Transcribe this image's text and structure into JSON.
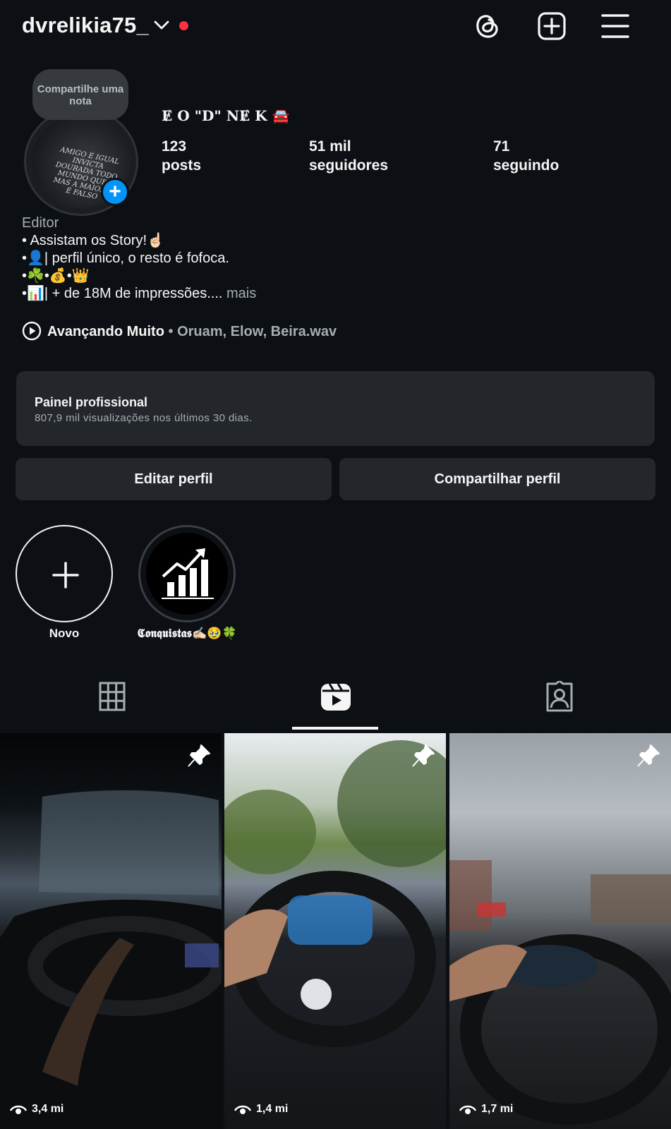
{
  "header": {
    "username": "dvrelikia75_",
    "icons": [
      "chevron-down-icon",
      "threads-icon",
      "create-post-icon",
      "menu-icon"
    ],
    "notification_dot_color": "#ff3040"
  },
  "profile": {
    "note": "Compartilhe uma nota",
    "display_name": "Ɇ O \"D\" NɆ K 🚘",
    "stats": [
      {
        "value": "123",
        "label": "posts"
      },
      {
        "value": "51 mil",
        "label": "seguidores"
      },
      {
        "value": "71",
        "label": "seguindo"
      }
    ],
    "category": "Editor",
    "bio_lines": [
      "• Assistam os Story!☝🏻",
      "•👤| perfil único, o resto é fofoca.",
      "•☘️•💰•👑",
      "•📊| + de 18M de impressões...."
    ],
    "bio_more": " mais",
    "music": {
      "song": "Avançando Muito",
      "separator": " • ",
      "artists": "Oruam, Elow, Beira.wav"
    }
  },
  "professional_panel": {
    "title": "Painel profissional",
    "subtitle": "807,9 mil visualizações nos últimos 30 dias."
  },
  "buttons": {
    "edit": "Editar perfil",
    "share": "Compartilhar perfil"
  },
  "highlights": [
    {
      "label": "Novo"
    },
    {
      "label": "𝕮𝖔𝖓𝖖𝖚𝖎𝖘𝖙𝖆𝖘✍🏻🥹🍀"
    }
  ],
  "tabs": [
    "grid-icon",
    "reels-icon",
    "tagged-icon"
  ],
  "active_tab": 1,
  "reels": [
    {
      "views": "3,4 mi",
      "pinned": true
    },
    {
      "views": "1,4 mi",
      "pinned": true
    },
    {
      "views": "1,7 mi",
      "pinned": true
    }
  ],
  "shirt_text": "AMIGO É IGUAL INVICTA DOURADA TODO MUNDO QUER MAS A MAIORIA É FALSO"
}
